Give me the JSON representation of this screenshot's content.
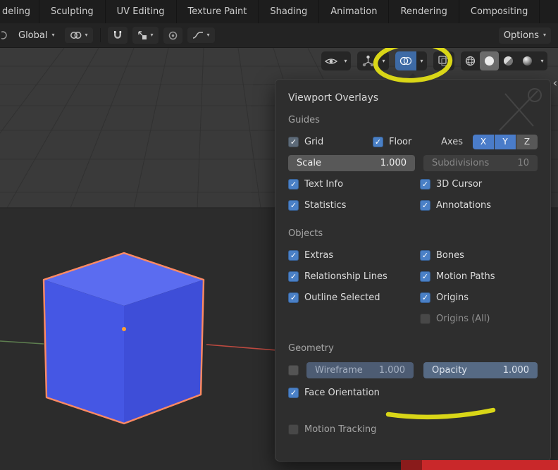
{
  "topbar": {
    "tabs": [
      "deling",
      "Sculpting",
      "UV Editing",
      "Texture Paint",
      "Shading",
      "Animation",
      "Rendering",
      "Compositing"
    ]
  },
  "toolbar": {
    "orientation": "Global",
    "options": "Options",
    "icons": {
      "pivot": "link-icon",
      "snap": "magnet-icon",
      "snap_target": "snap-target-icon",
      "proportional": "proportional-circle-icon",
      "falloff": "falloff-curve-icon"
    }
  },
  "viewport_header": {
    "icons": {
      "visibility": "eye-icon",
      "gizmos": "gizmo-icon",
      "overlays": "overlays-circles-icon",
      "xray": "xray-squares-icon",
      "shading_wireframe": "wireframe-sphere-icon",
      "shading_solid": "solid-sphere-icon",
      "shading_material": "material-sphere-icon",
      "shading_rendered": "rendered-sphere-icon"
    },
    "overlays_active": true,
    "shading_active": "solid"
  },
  "viewport": {
    "region_arrow": "‹"
  },
  "overlay_panel": {
    "title": "Viewport Overlays",
    "guides": {
      "label": "Guides",
      "grid": {
        "label": "Grid",
        "checked": true,
        "dimmed": true
      },
      "floor": {
        "label": "Floor",
        "checked": true
      },
      "axes_label": "Axes",
      "axes": [
        {
          "label": "X",
          "on": true
        },
        {
          "label": "Y",
          "on": true
        },
        {
          "label": "Z",
          "on": false
        }
      ],
      "scale": {
        "label": "Scale",
        "value": "1.000"
      },
      "subdivisions": {
        "label": "Subdivisions",
        "value": "10",
        "disabled": true
      },
      "text_info": {
        "label": "Text Info",
        "checked": true
      },
      "cursor_3d": {
        "label": "3D Cursor",
        "checked": true
      },
      "statistics": {
        "label": "Statistics",
        "checked": true
      },
      "annotations": {
        "label": "Annotations",
        "checked": true
      }
    },
    "objects": {
      "label": "Objects",
      "extras": {
        "label": "Extras",
        "checked": true
      },
      "bones": {
        "label": "Bones",
        "checked": true
      },
      "relationship_lines": {
        "label": "Relationship Lines",
        "checked": true
      },
      "motion_paths": {
        "label": "Motion Paths",
        "checked": true
      },
      "outline_selected": {
        "label": "Outline Selected",
        "checked": true
      },
      "origins": {
        "label": "Origins",
        "checked": true
      },
      "origins_all": {
        "label": "Origins (All)",
        "checked": false,
        "dimmed": true
      }
    },
    "geometry": {
      "label": "Geometry",
      "wireframe_enabled": false,
      "wireframe": {
        "label": "Wireframe",
        "value": "1.000",
        "disabled": true
      },
      "opacity": {
        "label": "Opacity",
        "value": "1.000"
      },
      "face_orientation": {
        "label": "Face Orientation",
        "checked": true,
        "highlighted": true
      }
    },
    "motion_tracking": {
      "label": "Motion Tracking",
      "checked": false
    }
  },
  "annotations": {
    "marker_color": "#e3df16",
    "circled_target": "overlays-dropdown",
    "underlined_target": "Face Orientation",
    "bottom_red_bar": true
  },
  "scene": {
    "object": "selected blue cube",
    "outline_color": "#ff8a63",
    "cube_top_color": "#5b6cf0",
    "cube_left_color": "#4557e4",
    "cube_right_color": "#3e4ed8",
    "origin_dot_color": "#ffa133"
  },
  "colors": {
    "accent_blue": "#4a7cc9",
    "header_bg": "#1d1d1d",
    "toolbar_bg": "#232323",
    "panel_bg": "#2e2e2e",
    "viewport_top": "#3a3a3a",
    "viewport_bottom": "#2c2c2c"
  }
}
